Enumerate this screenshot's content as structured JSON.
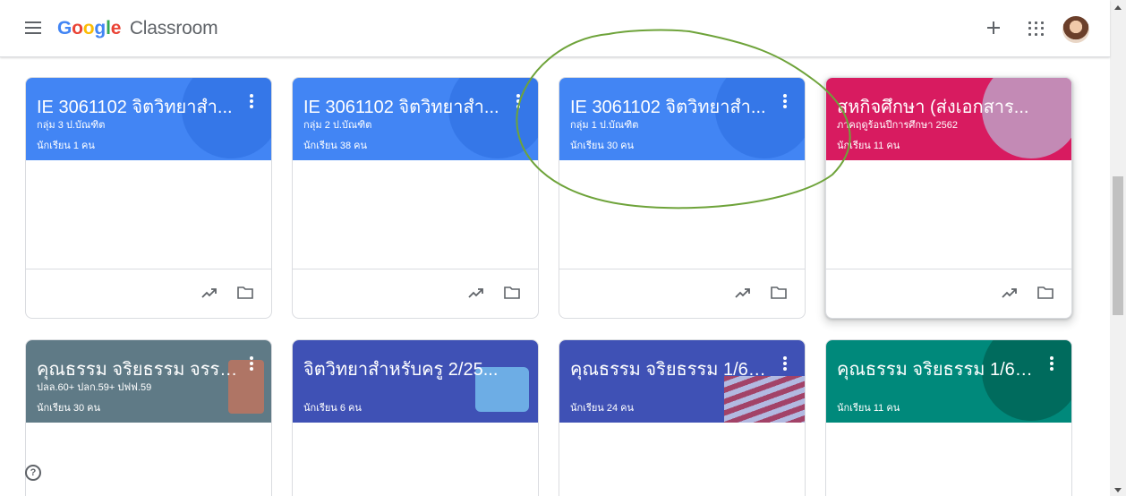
{
  "header": {
    "logo_google": [
      "G",
      "o",
      "o",
      "g",
      "l",
      "e"
    ],
    "logo_product": "Classroom",
    "menu_icon": "hamburger-menu-icon",
    "plus_icon": "plus-icon",
    "apps_icon": "apps-grid-icon"
  },
  "colors": {
    "blue": "#4285f4",
    "pink": "#d81b60",
    "slate": "#5f7a86",
    "indigo": "#3f51b5",
    "teal": "#00897b",
    "annotation": "#6ea33a"
  },
  "cards": [
    {
      "title": "IE 3061102 จิตวิทยาสำ...",
      "section": "กลุ่ม 3 ป.บัณฑิต",
      "count": "นักเรียน 1 คน"
    },
    {
      "title": "IE 3061102 จิตวิทยาสำ...",
      "section": "กลุ่ม 2 ป.บัณฑิต",
      "count": "นักเรียน 38 คน"
    },
    {
      "title": "IE 3061102 จิตวิทยาสำ...",
      "section": "กลุ่ม 1 ป.บัณฑิต",
      "count": "นักเรียน 30 คน"
    },
    {
      "title": "สหกิจศึกษา (ส่งเอกสาร...",
      "section": "ภาคฤดูร้อนปีการศึกษา 2562",
      "count": "นักเรียน 11 คน"
    },
    {
      "title": "คุณธรรม จริยธรรม จรรย...",
      "section": "ปลล.60+ ปลก.59+ ปฟฟ.59",
      "count": "นักเรียน 30 คน"
    },
    {
      "title": "จิตวิทยาสำหรับครู 2/25...",
      "section": "",
      "count": "นักเรียน 6 คน"
    },
    {
      "title": "คุณธรรม จริยธรรม 1/62 ...",
      "section": "",
      "count": "นักเรียน 24 คน"
    },
    {
      "title": "คุณธรรม จริยธรรม 1/62 ...",
      "section": "",
      "count": "นักเรียน 11 คน"
    }
  ],
  "footer_icons": [
    "trending-up-icon",
    "folder-icon"
  ],
  "help_icon": "help-circle-icon",
  "help_glyph": "?"
}
